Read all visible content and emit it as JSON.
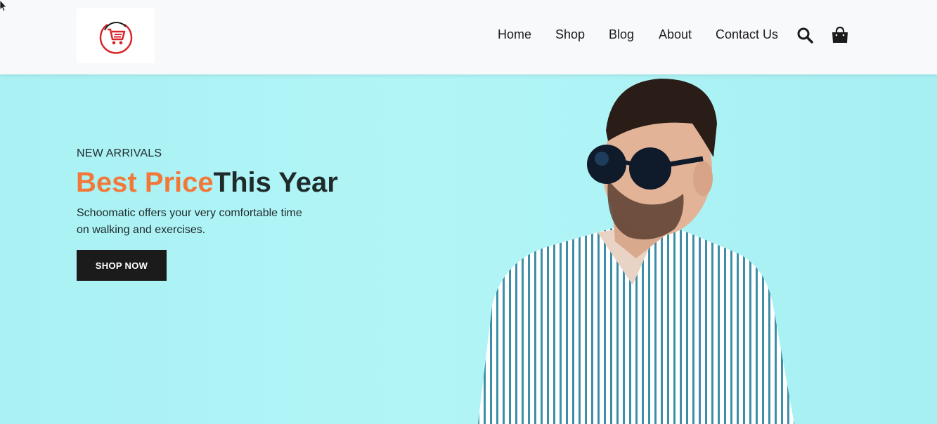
{
  "header": {
    "logo_icon": "shopping-cart-logo-icon",
    "nav": [
      "Home",
      "Shop",
      "Blog",
      "About",
      "Contact Us"
    ],
    "search_icon": "search-icon",
    "cart_icon": "shopping-bag-icon"
  },
  "hero": {
    "eyebrow": "NEW ARRIVALS",
    "headline_accent": "Best Price",
    "headline_rest": "This Year",
    "description_line1": "Schoomatic offers your very comfortable time",
    "description_line2": "on walking and exercises.",
    "cta_label": "SHOP NOW",
    "image_subject": "model-in-striped-shirt-and-sunglasses"
  },
  "colors": {
    "accent": "#f2783a",
    "hero_bg": "#aef4f6",
    "header_bg": "#f8f9fb",
    "button_bg": "#1b1b1b",
    "logo_red": "#d8262b"
  }
}
